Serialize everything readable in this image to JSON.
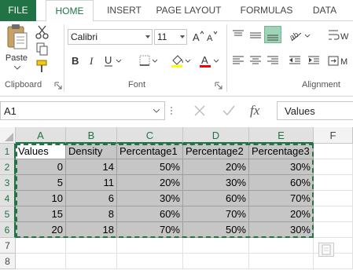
{
  "tabs": [
    {
      "label": "FILE"
    },
    {
      "label": "HOME"
    },
    {
      "label": "INSERT"
    },
    {
      "label": "PAGE LAYOUT"
    },
    {
      "label": "FORMULAS"
    },
    {
      "label": "DATA"
    }
  ],
  "ribbon": {
    "clipboard": {
      "paste_label": "Paste",
      "group_label": "Clipboard"
    },
    "font": {
      "name": "Calibri",
      "size": "11",
      "group_label": "Font"
    },
    "alignment": {
      "group_label": "Alignment"
    }
  },
  "formula_bar": {
    "name_box": "A1",
    "fx_label": "fx",
    "content": "Values"
  },
  "columns": [
    "A",
    "B",
    "C",
    "D",
    "E",
    "F"
  ],
  "rows": [
    "1",
    "2",
    "3",
    "4",
    "5",
    "6",
    "7",
    "8"
  ],
  "sheet": {
    "header": [
      "Values",
      "Density",
      "Percentage1",
      "Percentage2",
      "Percentage3"
    ],
    "data": [
      [
        "0",
        "14",
        "50%",
        "20%",
        "30%"
      ],
      [
        "5",
        "11",
        "20%",
        "30%",
        "60%"
      ],
      [
        "10",
        "6",
        "30%",
        "60%",
        "70%"
      ],
      [
        "15",
        "8",
        "60%",
        "70%",
        "20%"
      ],
      [
        "20",
        "18",
        "70%",
        "50%",
        "30%"
      ]
    ]
  },
  "colors": {
    "accent": "#217346",
    "selection": "#c6c6c6"
  }
}
